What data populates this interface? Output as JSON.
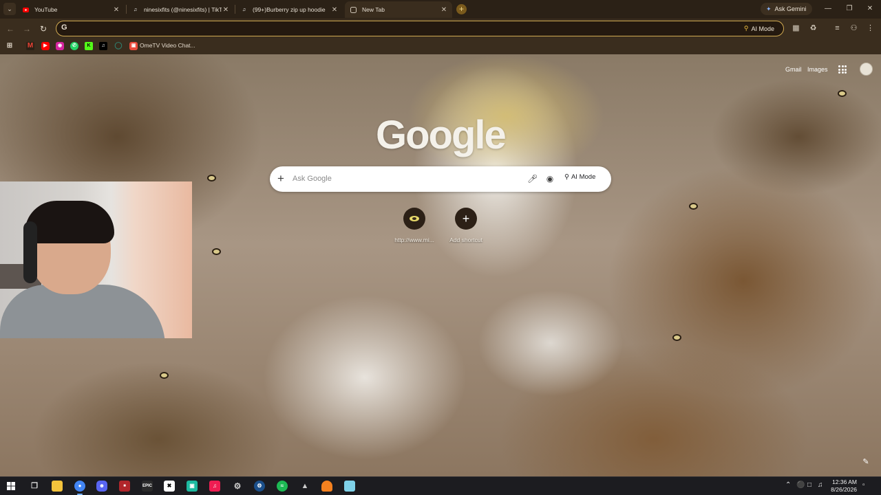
{
  "browser": {
    "tabs": [
      {
        "title": "YouTube",
        "icon": "youtube-icon",
        "active": false
      },
      {
        "title": "ninesixfits (@ninesixfits) | TikTok",
        "icon": "tiktok-icon",
        "active": false
      },
      {
        "title": "(99+)Burberry zip up hoodie",
        "icon": "tiktok-icon",
        "active": false
      },
      {
        "title": "New Tab",
        "icon": "new-tab-icon",
        "active": true
      }
    ],
    "ask_gemini_label": "Ask Gemini",
    "omnibox": {
      "value": "",
      "ai_mode_label": "AI Mode"
    },
    "bookmarks": [
      {
        "icon": "gmail-icon",
        "label": ""
      },
      {
        "icon": "youtube-icon",
        "label": ""
      },
      {
        "icon": "instagram-icon",
        "label": ""
      },
      {
        "icon": "whatsapp-icon",
        "label": ""
      },
      {
        "icon": "kick-icon",
        "label": ""
      },
      {
        "icon": "tiktok-icon",
        "label": ""
      },
      {
        "icon": "globe-icon",
        "label": ""
      },
      {
        "icon": "ometv-icon",
        "label": "OmeTV Video Chat..."
      }
    ]
  },
  "newtab": {
    "gmail_link": "Gmail",
    "images_link": "Images",
    "logo": "Google",
    "search_placeholder": "Ask Google",
    "ai_mode_label": "AI Mode",
    "shortcuts": [
      {
        "label": "http://www.mi...",
        "icon": "site-favicon-icon"
      },
      {
        "label": "Add shortcut",
        "icon": "plus-icon"
      }
    ]
  },
  "taskbar": {
    "time": "12:36 AM",
    "date": "8/26/2026",
    "apps": [
      "start",
      "task-view",
      "file-explorer",
      "chrome",
      "discord",
      "app",
      "epic-games",
      "capcut",
      "app",
      "tiktok",
      "app",
      "steam",
      "spotify",
      "app",
      "app",
      "notepad"
    ]
  },
  "colors": {
    "accent": "#d2ab52",
    "tab_strip": "#2b2116",
    "toolbar": "#3a2d1e",
    "taskbar": "#1c1c20"
  }
}
